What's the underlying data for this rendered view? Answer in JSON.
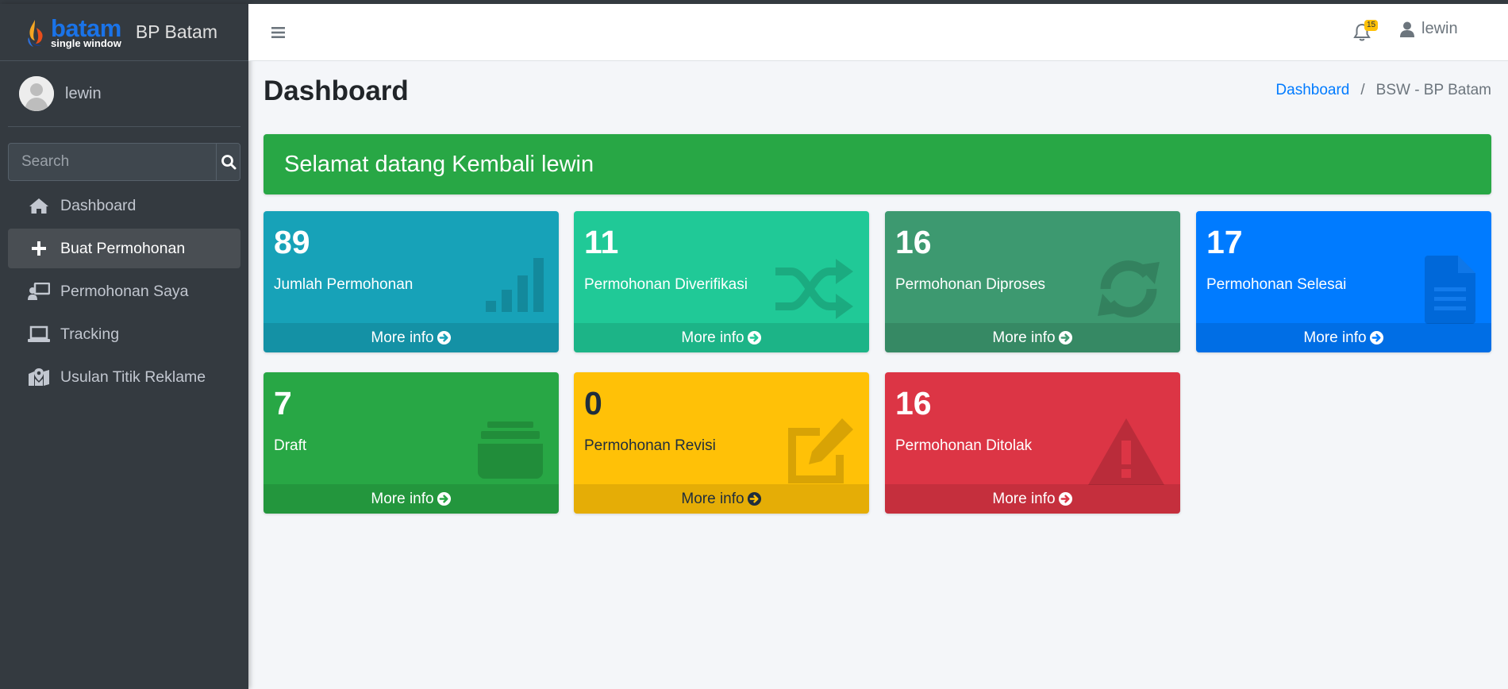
{
  "brand": {
    "logo_word": "batam",
    "logo_sub": "single window",
    "text": "BP Batam"
  },
  "sidebar": {
    "user_name": "lewin",
    "search_placeholder": "Search",
    "items": [
      {
        "label": "Dashboard",
        "icon": "home-icon",
        "active": false
      },
      {
        "label": "Buat Permohonan",
        "icon": "plus-icon",
        "active": true
      },
      {
        "label": "Permohonan Saya",
        "icon": "person-board-icon",
        "active": false
      },
      {
        "label": "Tracking",
        "icon": "laptop-icon",
        "active": false
      },
      {
        "label": "Usulan Titik Reklame",
        "icon": "map-marker-icon",
        "active": false
      }
    ]
  },
  "header": {
    "notification_count": "15",
    "user_name": "lewin"
  },
  "page": {
    "title": "Dashboard",
    "breadcrumb": [
      "Dashboard",
      "BSW - BP Batam"
    ],
    "welcome": "Selamat datang Kembali lewin"
  },
  "stats": [
    {
      "value": "89",
      "label": "Jumlah Permohonan",
      "more": "More info",
      "color": "#17a2b8",
      "icon": "signal-bars-icon"
    },
    {
      "value": "11",
      "label": "Permohonan Diverifikasi",
      "more": "More info",
      "color": "#20c997",
      "icon": "shuffle-icon"
    },
    {
      "value": "16",
      "label": "Permohonan Diproses",
      "more": "More info",
      "color": "#3d9970",
      "icon": "refresh-icon"
    },
    {
      "value": "17",
      "label": "Permohonan Selesai",
      "more": "More info",
      "color": "#007bff",
      "icon": "document-icon"
    },
    {
      "value": "7",
      "label": "Draft",
      "more": "More info",
      "color": "#28a745",
      "icon": "archive-icon"
    },
    {
      "value": "0",
      "label": "Permohonan Revisi",
      "more": "More info",
      "color": "#ffc107",
      "icon": "edit-icon"
    },
    {
      "value": "16",
      "label": "Permohonan Ditolak",
      "more": "More info",
      "color": "#dc3545",
      "icon": "warning-icon"
    }
  ]
}
